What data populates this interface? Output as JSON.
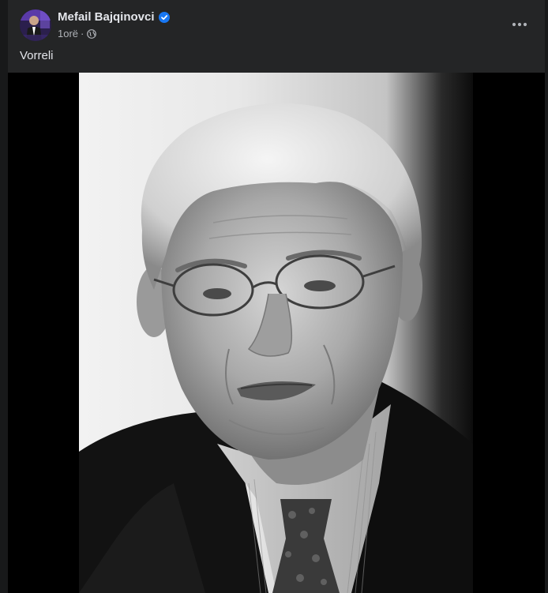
{
  "post": {
    "author_name": "Mefail Bajqinovci",
    "timestamp": "1orë",
    "separator": "·",
    "audience_icon": "globe-icon",
    "verified_icon": "verified-badge-icon",
    "more_icon": "more-options-icon",
    "text": "Vorreli",
    "photo_description_icon": "portrait-photo"
  },
  "colors": {
    "background": "#18191a",
    "card": "#242526",
    "primary_text": "#e4e6eb",
    "secondary_text": "#b0b3b8",
    "verified_blue": "#1877f2"
  }
}
